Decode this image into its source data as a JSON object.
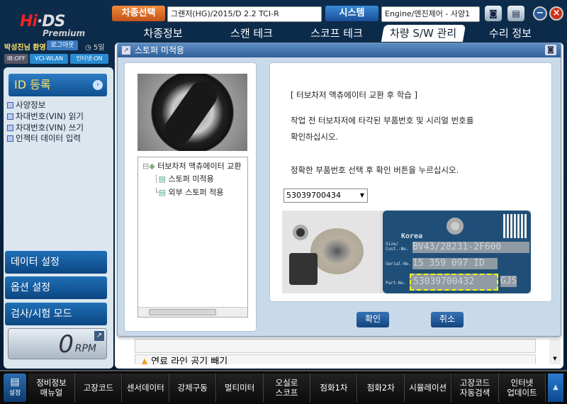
{
  "header": {
    "logo": "Hi-DS Premium",
    "vehicle_select_label": "차종선택",
    "vehicle_value": "그랜저(HG)/2015/D 2.2 TCI-R",
    "system_label": "시스템",
    "system_value": "Engine/엔진제어 - 사양1"
  },
  "tabs": [
    "차종정보",
    "스캔 테크",
    "스코프 테크",
    "차량 S/W 관리",
    "수리 정보"
  ],
  "user": {
    "greeting": "박성진님 환영",
    "logout": "로그아웃",
    "days": "5일",
    "ib": "IB:OFF",
    "vci": "VCI-WLAN",
    "internet": "인터넷:ON"
  },
  "sidebar": {
    "header": "ID 등록",
    "items": [
      "사양정보",
      "차대번호(VIN) 읽기",
      "차대번호(VIN) 쓰기",
      "인젝터 데이터 입력"
    ],
    "buttons": [
      "데이터 설정",
      "옵션 설정",
      "검사/시험 모드"
    ],
    "rpm_value": "0",
    "rpm_unit": "RPM"
  },
  "dialog": {
    "title": "스토퍼 미적용",
    "tree": {
      "root": "터보차저 액츄에이터 교환",
      "children": [
        "스토퍼 미적용",
        "외부 스토퍼 적용"
      ]
    },
    "lines": [
      "[ 터보차저 액츄에이터 교환 후 학습 ]",
      "작업 전 터보차저에 타각된 부품번호 및 시리얼 번호를",
      "확인하십시오.",
      "정확한 부품번호 선택 후 확인 버튼을 누르십시오."
    ],
    "part_select": "53039700434",
    "plate": {
      "brand": "Korea",
      "size_label": "Size/ Cust.-No.",
      "size": "BV43/28231-2F600",
      "serial_label": "Serial-No.",
      "serial": "15 359 097 ID",
      "part_label": "Part-No.",
      "part": "53039700432",
      "suffix": "GJS"
    },
    "ok": "확인",
    "cancel": "취소"
  },
  "background_item": "연료 라인 공기 빼기",
  "toolbar": {
    "settings": "설정",
    "items": [
      "정비정보\n매뉴얼",
      "고장코드",
      "센서데이터",
      "강제구동",
      "멀티미터",
      "오실로\n스코프",
      "점화1차",
      "점화2차",
      "시뮬레이션",
      "고장코드\n자동검색",
      "인터넷\n업데이트"
    ]
  }
}
